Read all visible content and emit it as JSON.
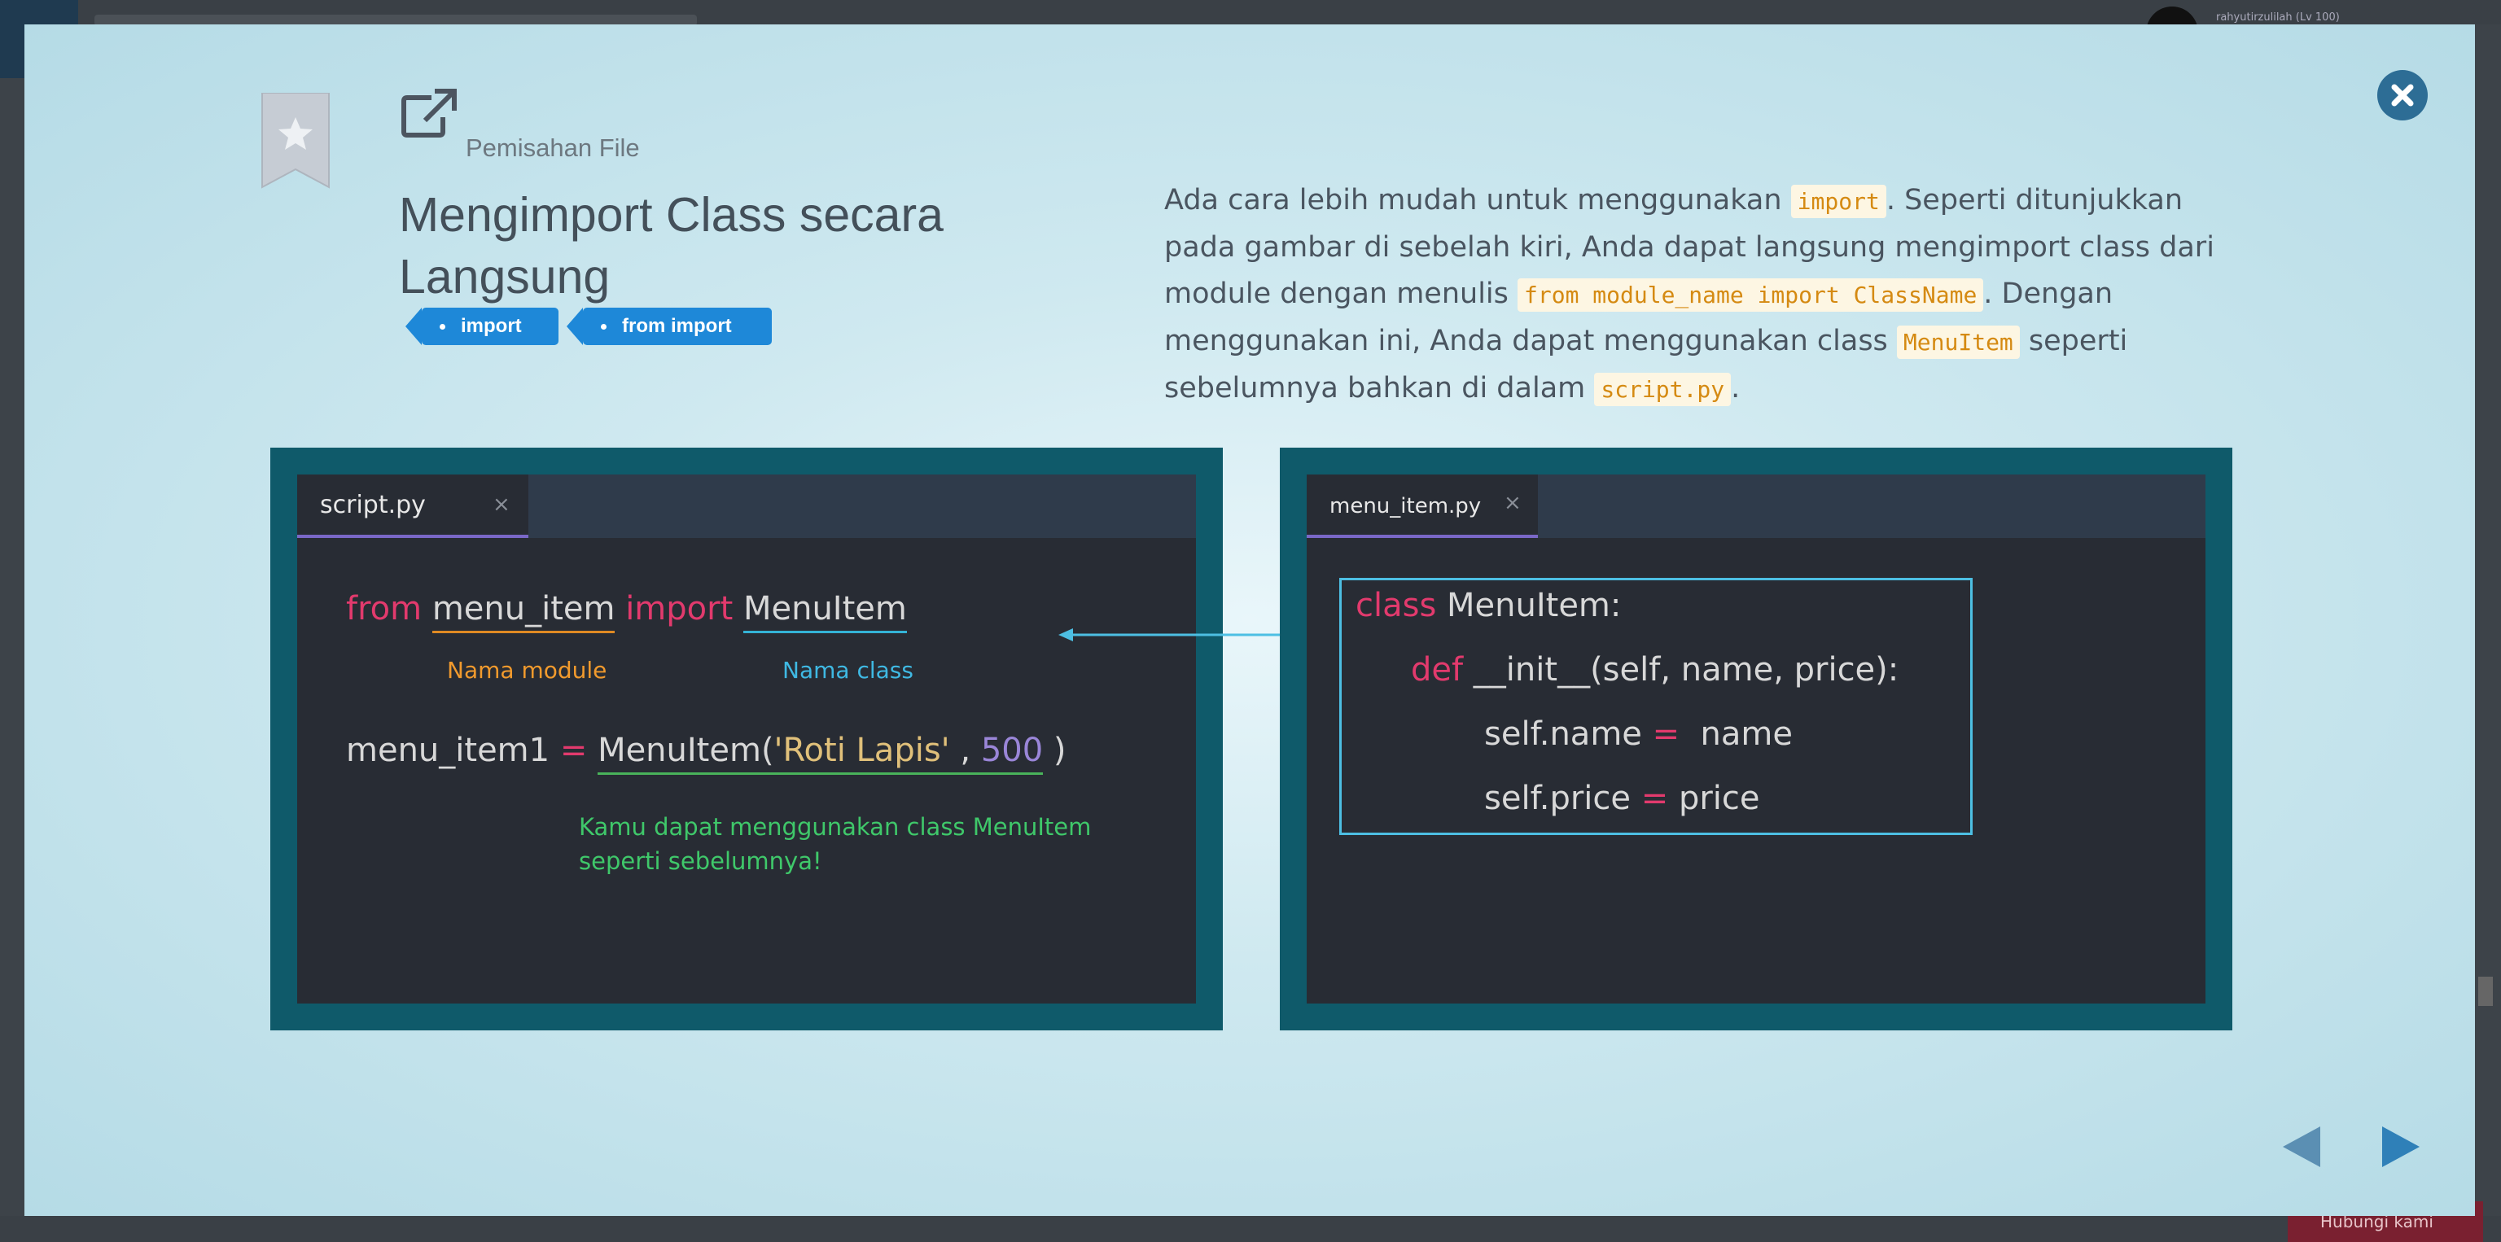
{
  "background": {
    "user_label": "rahyutirzulilah (Lv 100)",
    "bottom_button_label": "Hubungi kami"
  },
  "modal": {
    "breadcrumb": "Pemisahan File",
    "title": "Mengimport Class secara Langsung",
    "tags": [
      "import",
      "from import"
    ],
    "description": {
      "p1": "Ada cara lebih mudah untuk menggunakan ",
      "code1": "import",
      "p2": ". Seperti ditunjukkan pada gambar di sebelah kiri, Anda dapat langsung mengimport class dari module dengan menulis ",
      "code2": "from module_name import ClassName",
      "p3": ". Dengan menggunakan ini, Anda dapat menggunakan class ",
      "code3": "MenuItem",
      "p4": " seperti sebelumnya bahkan di dalam ",
      "code4": "script.py",
      "p5": "."
    }
  },
  "left_editor": {
    "tab_name": "script.py",
    "tab_close": "×",
    "line1": {
      "kw_from": "from",
      "module": "menu_item",
      "kw_import": "import",
      "class_name": "MenuItem"
    },
    "label_module": "Nama module",
    "label_class": "Nama class",
    "line2": {
      "var": "menu_item1",
      "op": "=",
      "call": "MenuItem(",
      "str": "'Roti Lapis'",
      "comma": " , ",
      "num": "500",
      "close": " )"
    },
    "note_line1": "Kamu dapat menggunakan class MenuItem",
    "note_line2": "seperti sebelumnya!"
  },
  "right_editor": {
    "tab_name": "menu_item.py",
    "tab_close": "×",
    "line1": {
      "kw": "class",
      "rest": " MenuItem:"
    },
    "line2": {
      "kw": "def",
      "rest": " __init__(self, name, price):"
    },
    "line3": {
      "lhs": "self.name ",
      "op": "=",
      "rhs": "  name"
    },
    "line4": {
      "lhs": "self.price ",
      "op": "=",
      "rhs": " price"
    }
  },
  "colors": {
    "accent_blue": "#1e88d8",
    "close_button": "#2d6d95",
    "panel_border": "#0f5a6a",
    "code_keyword": "#e23a6d"
  }
}
